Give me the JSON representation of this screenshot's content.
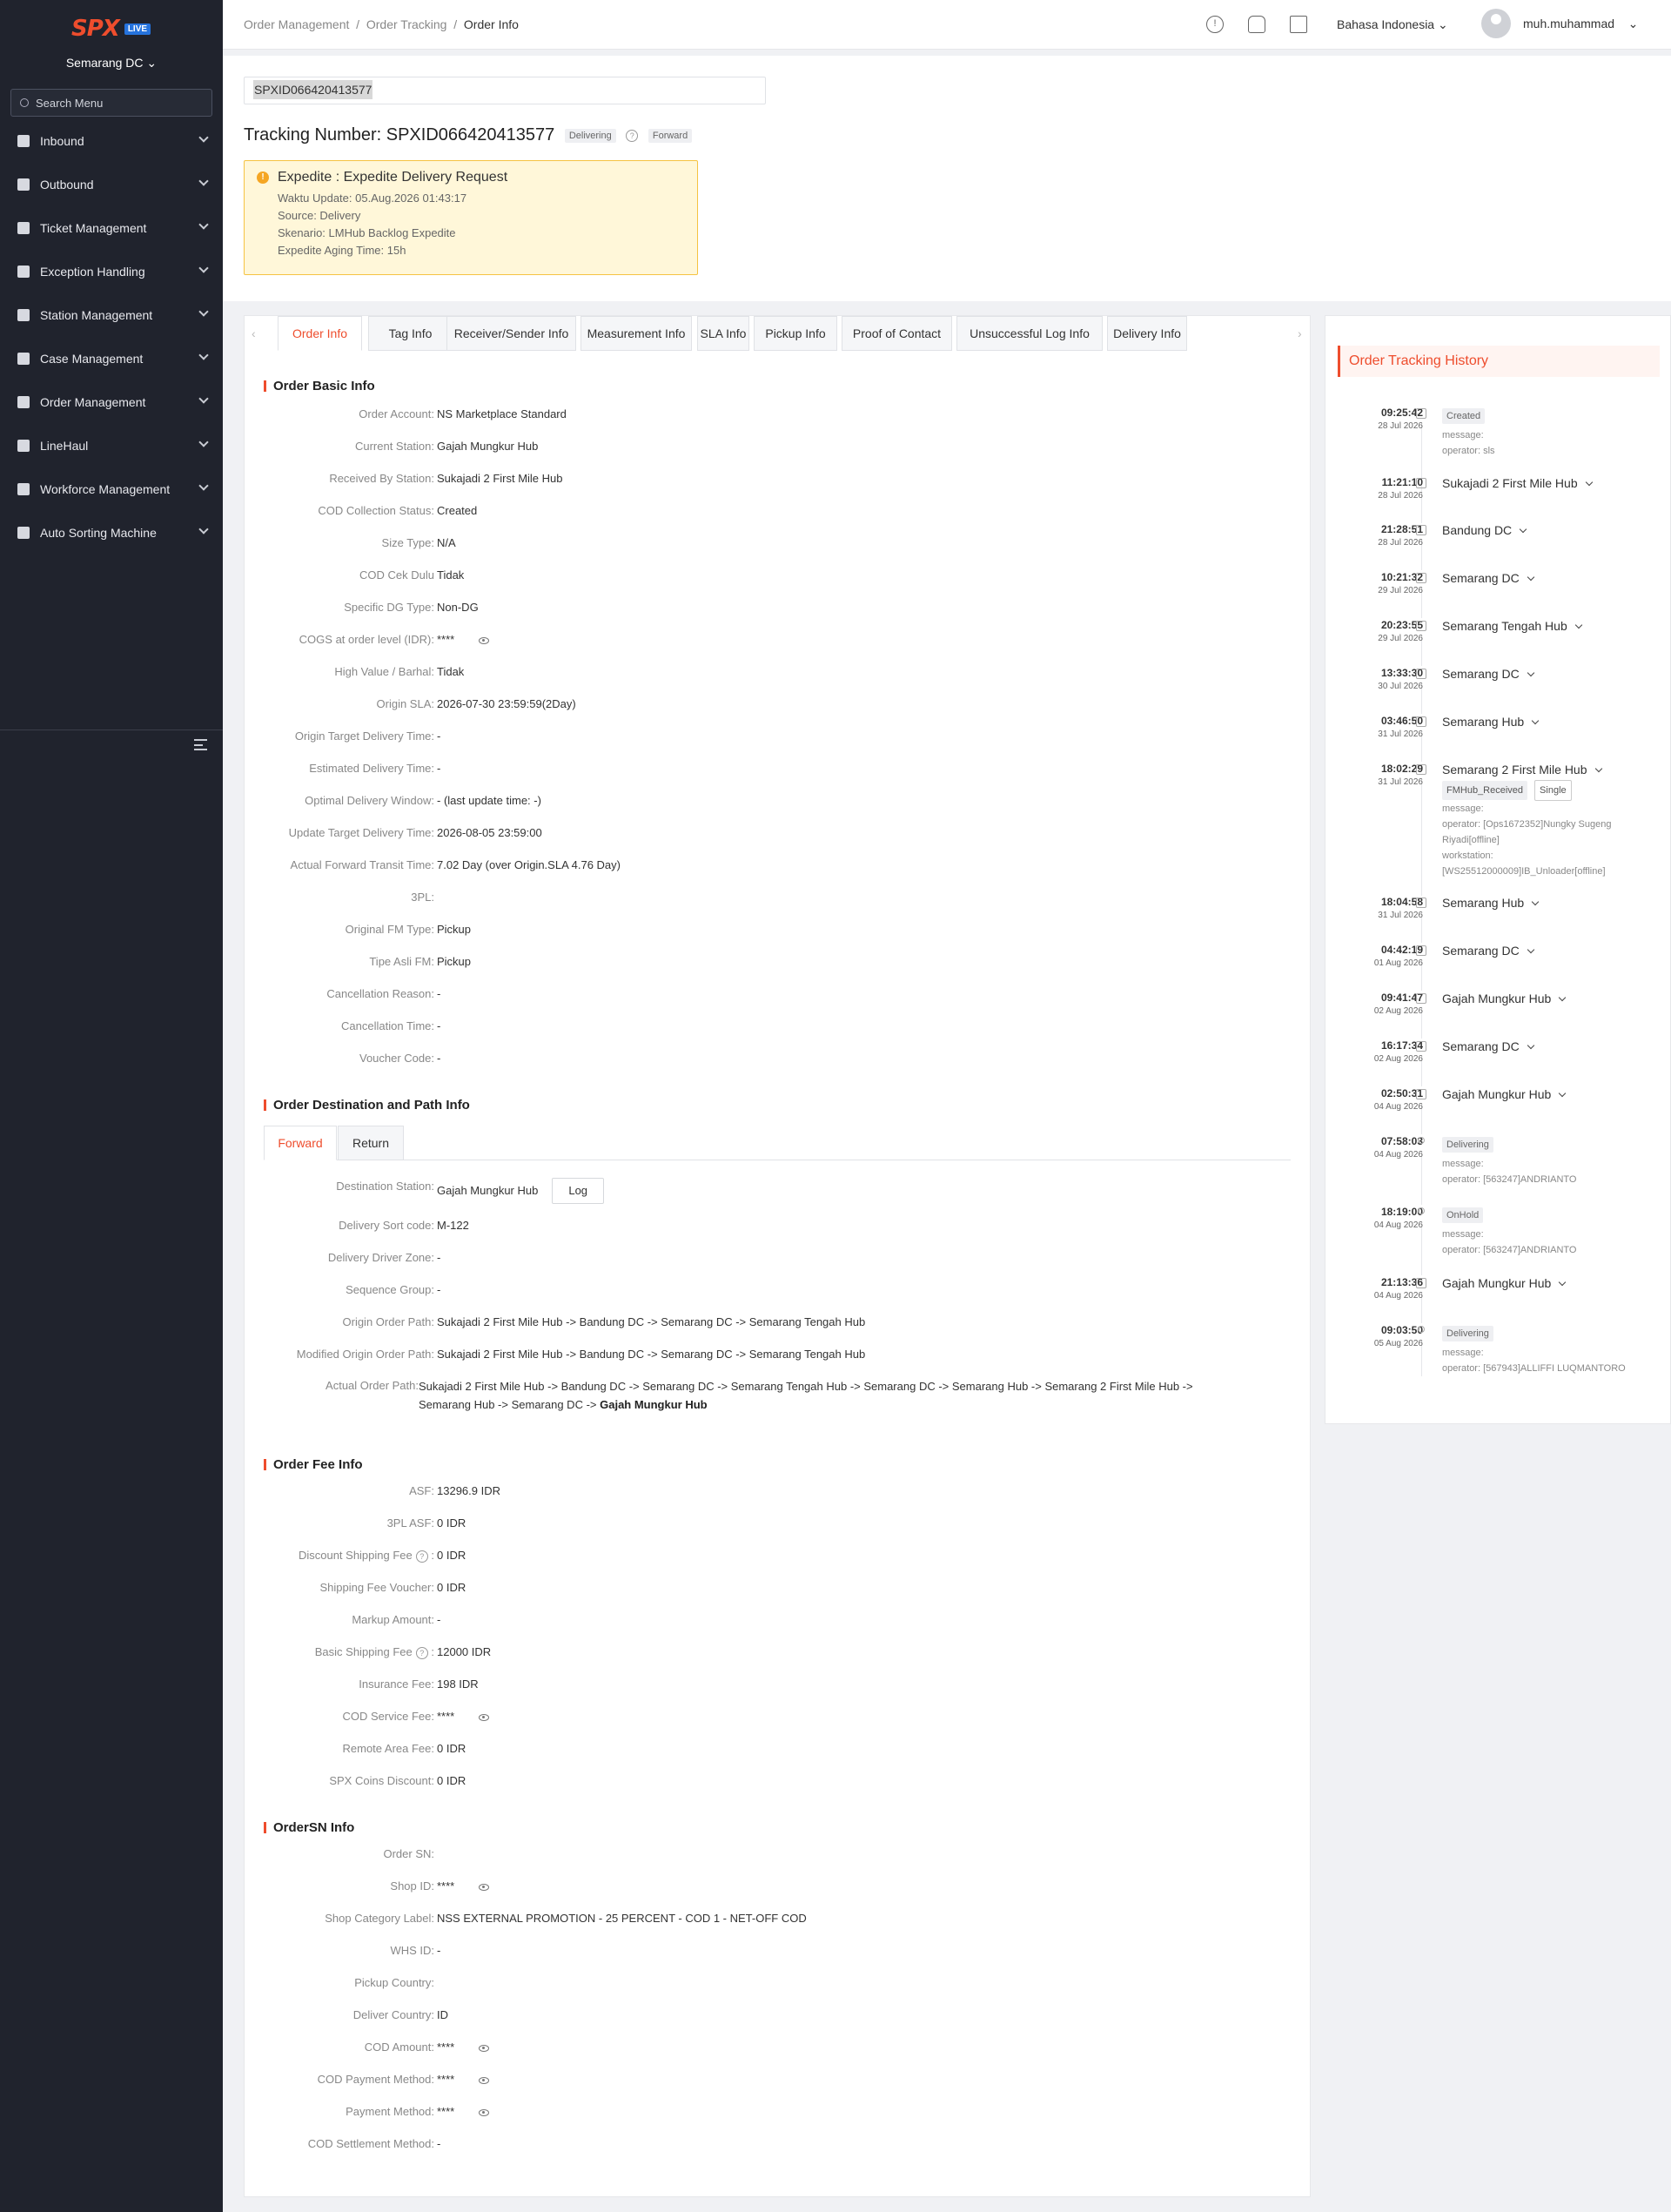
{
  "sidebar": {
    "logo": "SPX",
    "live": "LIVE",
    "station": "Semarang DC",
    "search_placeholder": "Search Menu",
    "items": [
      {
        "label": "Inbound"
      },
      {
        "label": "Outbound"
      },
      {
        "label": "Ticket Management"
      },
      {
        "label": "Exception Handling"
      },
      {
        "label": "Station Management"
      },
      {
        "label": "Case Management"
      },
      {
        "label": "Order Management"
      },
      {
        "label": "LineHaul"
      },
      {
        "label": "Workforce Management"
      },
      {
        "label": "Auto Sorting Machine"
      }
    ]
  },
  "header": {
    "breadcrumb": [
      "Order Management",
      "Order Tracking",
      "Order Info"
    ],
    "language": "Bahasa Indonesia",
    "user": "muh.muhammad"
  },
  "order": {
    "input_value": "SPXID066420413577",
    "title": "Tracking Number: SPXID066420413577",
    "status": "Delivering",
    "direction": "Forward",
    "expedite": {
      "heading": "Expedite : Expedite Delivery Request",
      "lines": [
        "Waktu Update: 05.Aug.2026 01:43:17",
        "Source: Delivery",
        "Skenario: LMHub Backlog Expedite",
        "Expedite Aging Time: 15h"
      ]
    }
  },
  "tabs": [
    "Order Info",
    "Tag Info",
    "Receiver/Sender Info",
    "Measurement Info",
    "SLA Info",
    "Pickup Info",
    "Proof of Contact",
    "Unsuccessful Log Info",
    "Delivery Info"
  ],
  "basic": {
    "title": "Order Basic Info",
    "rows": [
      {
        "label": "Order Account:",
        "value": "NS Marketplace Standard"
      },
      {
        "label": "Current Station:",
        "value": "Gajah Mungkur Hub"
      },
      {
        "label": "Received By Station:",
        "value": "Sukajadi 2 First Mile Hub"
      },
      {
        "label": "COD Collection Status:",
        "value": "Created"
      },
      {
        "label": "Size Type:",
        "value": "N/A"
      },
      {
        "label": "COD Cek Dulu",
        "value": "Tidak"
      },
      {
        "label": "Specific DG Type:",
        "value": "Non-DG"
      },
      {
        "label": "COGS at order level (IDR):",
        "value": "****",
        "eye": true
      },
      {
        "label": "High Value / Barhal:",
        "value": "Tidak"
      },
      {
        "label": "Origin SLA:",
        "value": "2026-07-30 23:59:59(2Day)"
      },
      {
        "label": "Origin Target Delivery Time:",
        "value": "-"
      },
      {
        "label": "Estimated Delivery Time:",
        "value": "-"
      },
      {
        "label": "Optimal Delivery Window:",
        "value": "- (last update time: -)"
      },
      {
        "label": "Update Target Delivery Time:",
        "value": "2026-08-05 23:59:00"
      },
      {
        "label": "Actual Forward Transit Time:",
        "value": "7.02 Day (over Origin.SLA 4.76 Day)"
      },
      {
        "label": "3PL:",
        "value": ""
      },
      {
        "label": "Original FM Type:",
        "value": "Pickup"
      },
      {
        "label": "Tipe Asli FM:",
        "value": "Pickup"
      },
      {
        "label": "Cancellation Reason:",
        "value": "-"
      },
      {
        "label": "Cancellation Time:",
        "value": "-"
      },
      {
        "label": "Voucher Code:",
        "value": "-"
      }
    ]
  },
  "dest": {
    "title": "Order Destination and Path Info",
    "subtabs": [
      "Forward",
      "Return"
    ],
    "log_label": "Log",
    "rows": [
      {
        "label": "Destination Station:",
        "value": "Gajah Mungkur Hub"
      },
      {
        "label": "Delivery Sort code:",
        "value": "M-122"
      },
      {
        "label": "Delivery Driver Zone:",
        "value": "-"
      },
      {
        "label": "Sequence Group:",
        "value": "-"
      },
      {
        "label": "Origin Order Path:",
        "value": "Sukajadi 2 First Mile Hub  -> Bandung DC  -> Semarang DC  -> Semarang Tengah Hub"
      },
      {
        "label": "Modified Origin Order Path:",
        "value": "Sukajadi 2 First Mile Hub  -> Bandung DC  -> Semarang DC  -> Semarang Tengah Hub"
      }
    ],
    "actual_label": "Actual Order Path:",
    "actual_line1": "Sukajadi 2 First Mile Hub  -> Bandung DC  -> Semarang DC  -> Semarang Tengah Hub  -> Semarang DC  -> Semarang Hub  -> Semarang 2 First Mile Hub  ->",
    "actual_line2": "Semarang Hub  -> Semarang DC  -> ",
    "actual_last": "Gajah Mungkur Hub"
  },
  "fee": {
    "title": "Order Fee Info",
    "rows": [
      {
        "label": "ASF:",
        "value": "13296.9 IDR"
      },
      {
        "label": "3PL ASF:",
        "value": "0 IDR"
      },
      {
        "label": "Discount Shipping Fee",
        "value": "0 IDR",
        "q": true
      },
      {
        "label": "Shipping Fee Voucher:",
        "value": "0 IDR"
      },
      {
        "label": "Markup Amount:",
        "value": "-"
      },
      {
        "label": "Basic Shipping Fee",
        "value": "12000 IDR",
        "q": true
      },
      {
        "label": "Insurance Fee:",
        "value": "198 IDR"
      },
      {
        "label": "COD Service Fee:",
        "value": "****",
        "eye": true
      },
      {
        "label": "Remote Area Fee:",
        "value": "0 IDR"
      },
      {
        "label": "SPX Coins Discount:",
        "value": "0 IDR"
      }
    ]
  },
  "ordersn": {
    "title": "OrderSN Info",
    "rows": [
      {
        "label": "Order SN:",
        "value": ""
      },
      {
        "label": "Shop ID:",
        "value": "****",
        "eye": true
      },
      {
        "label": "Shop Category Label:",
        "value": "NSS EXTERNAL PROMOTION - 25 PERCENT - COD 1 - NET-OFF COD"
      },
      {
        "label": "WHS ID:",
        "value": "-"
      },
      {
        "label": "Pickup Country:",
        "value": ""
      },
      {
        "label": "Deliver Country:",
        "value": "ID"
      },
      {
        "label": "COD Amount:",
        "value": "****",
        "eye": true
      },
      {
        "label": "COD Payment Method:",
        "value": "****",
        "eye": true
      },
      {
        "label": "Payment Method:",
        "value": "****",
        "eye": true
      },
      {
        "label": "COD Settlement Method:",
        "value": "-"
      }
    ]
  },
  "history": {
    "title": "Order Tracking History",
    "events": [
      {
        "time": "09:25:42",
        "date": "28 Jul 2026",
        "pill": "Created",
        "msg": [
          "message:",
          "operator: sls"
        ]
      },
      {
        "time": "11:21:10",
        "date": "28 Jul 2026",
        "station": "Sukajadi 2 First Mile Hub"
      },
      {
        "time": "21:28:51",
        "date": "28 Jul 2026",
        "station": "Bandung DC"
      },
      {
        "time": "10:21:32",
        "date": "29 Jul 2026",
        "station": "Semarang DC"
      },
      {
        "time": "20:23:55",
        "date": "29 Jul 2026",
        "station": "Semarang Tengah Hub"
      },
      {
        "time": "13:33:30",
        "date": "30 Jul 2026",
        "station": "Semarang DC"
      },
      {
        "time": "03:46:50",
        "date": "31 Jul 2026",
        "station": "Semarang Hub"
      },
      {
        "time": "18:02:29",
        "date": "31 Jul 2026",
        "station": "Semarang 2 First Mile Hub",
        "tags": [
          "FMHub_Received",
          "Single"
        ],
        "msg": [
          "message:",
          "operator: [Ops1672352]Nungky Sugeng",
          "Riyadi[offline]",
          "workstation:",
          "[WS25512000009]IB_Unloader[offline]"
        ]
      },
      {
        "time": "18:04:58",
        "date": "31 Jul 2026",
        "station": "Semarang Hub"
      },
      {
        "time": "04:42:19",
        "date": "01 Aug 2026",
        "station": "Semarang DC"
      },
      {
        "time": "09:41:47",
        "date": "02 Aug 2026",
        "station": "Gajah Mungkur Hub"
      },
      {
        "time": "16:17:34",
        "date": "02 Aug 2026",
        "station": "Semarang DC"
      },
      {
        "time": "02:50:31",
        "date": "04 Aug 2026",
        "station": "Gajah Mungkur Hub"
      },
      {
        "time": "07:58:03",
        "date": "04 Aug 2026",
        "pill": "Delivering",
        "msg": [
          "message:",
          "operator: [563247]ANDRIANTO"
        ]
      },
      {
        "time": "18:19:00",
        "date": "04 Aug 2026",
        "pill": "OnHold",
        "msg": [
          "message:",
          "operator: [563247]ANDRIANTO"
        ]
      },
      {
        "time": "21:13:36",
        "date": "04 Aug 2026",
        "station": "Gajah Mungkur Hub"
      },
      {
        "time": "09:03:50",
        "date": "05 Aug 2026",
        "pill": "Delivering",
        "msg": [
          "message:",
          "operator: [567943]ALLIFFI LUQMANTORO"
        ]
      }
    ]
  }
}
